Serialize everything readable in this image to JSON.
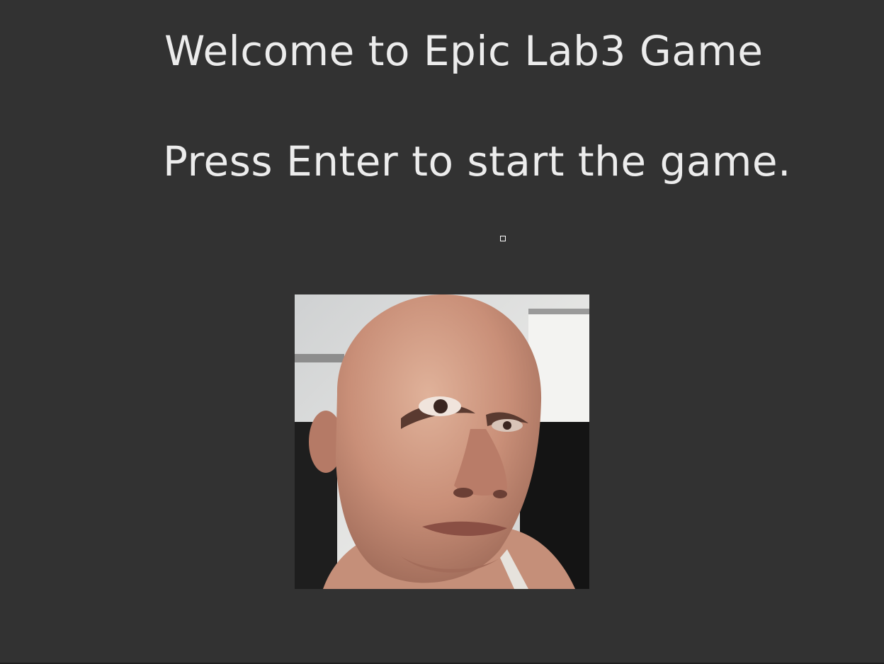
{
  "screen": {
    "title": "Welcome to Epic Lab3 Game",
    "prompt": "Press Enter to start the game."
  },
  "colors": {
    "background": "#323232",
    "text": "#ececec"
  },
  "icons": {
    "pointer": "small-square-cursor-icon"
  }
}
